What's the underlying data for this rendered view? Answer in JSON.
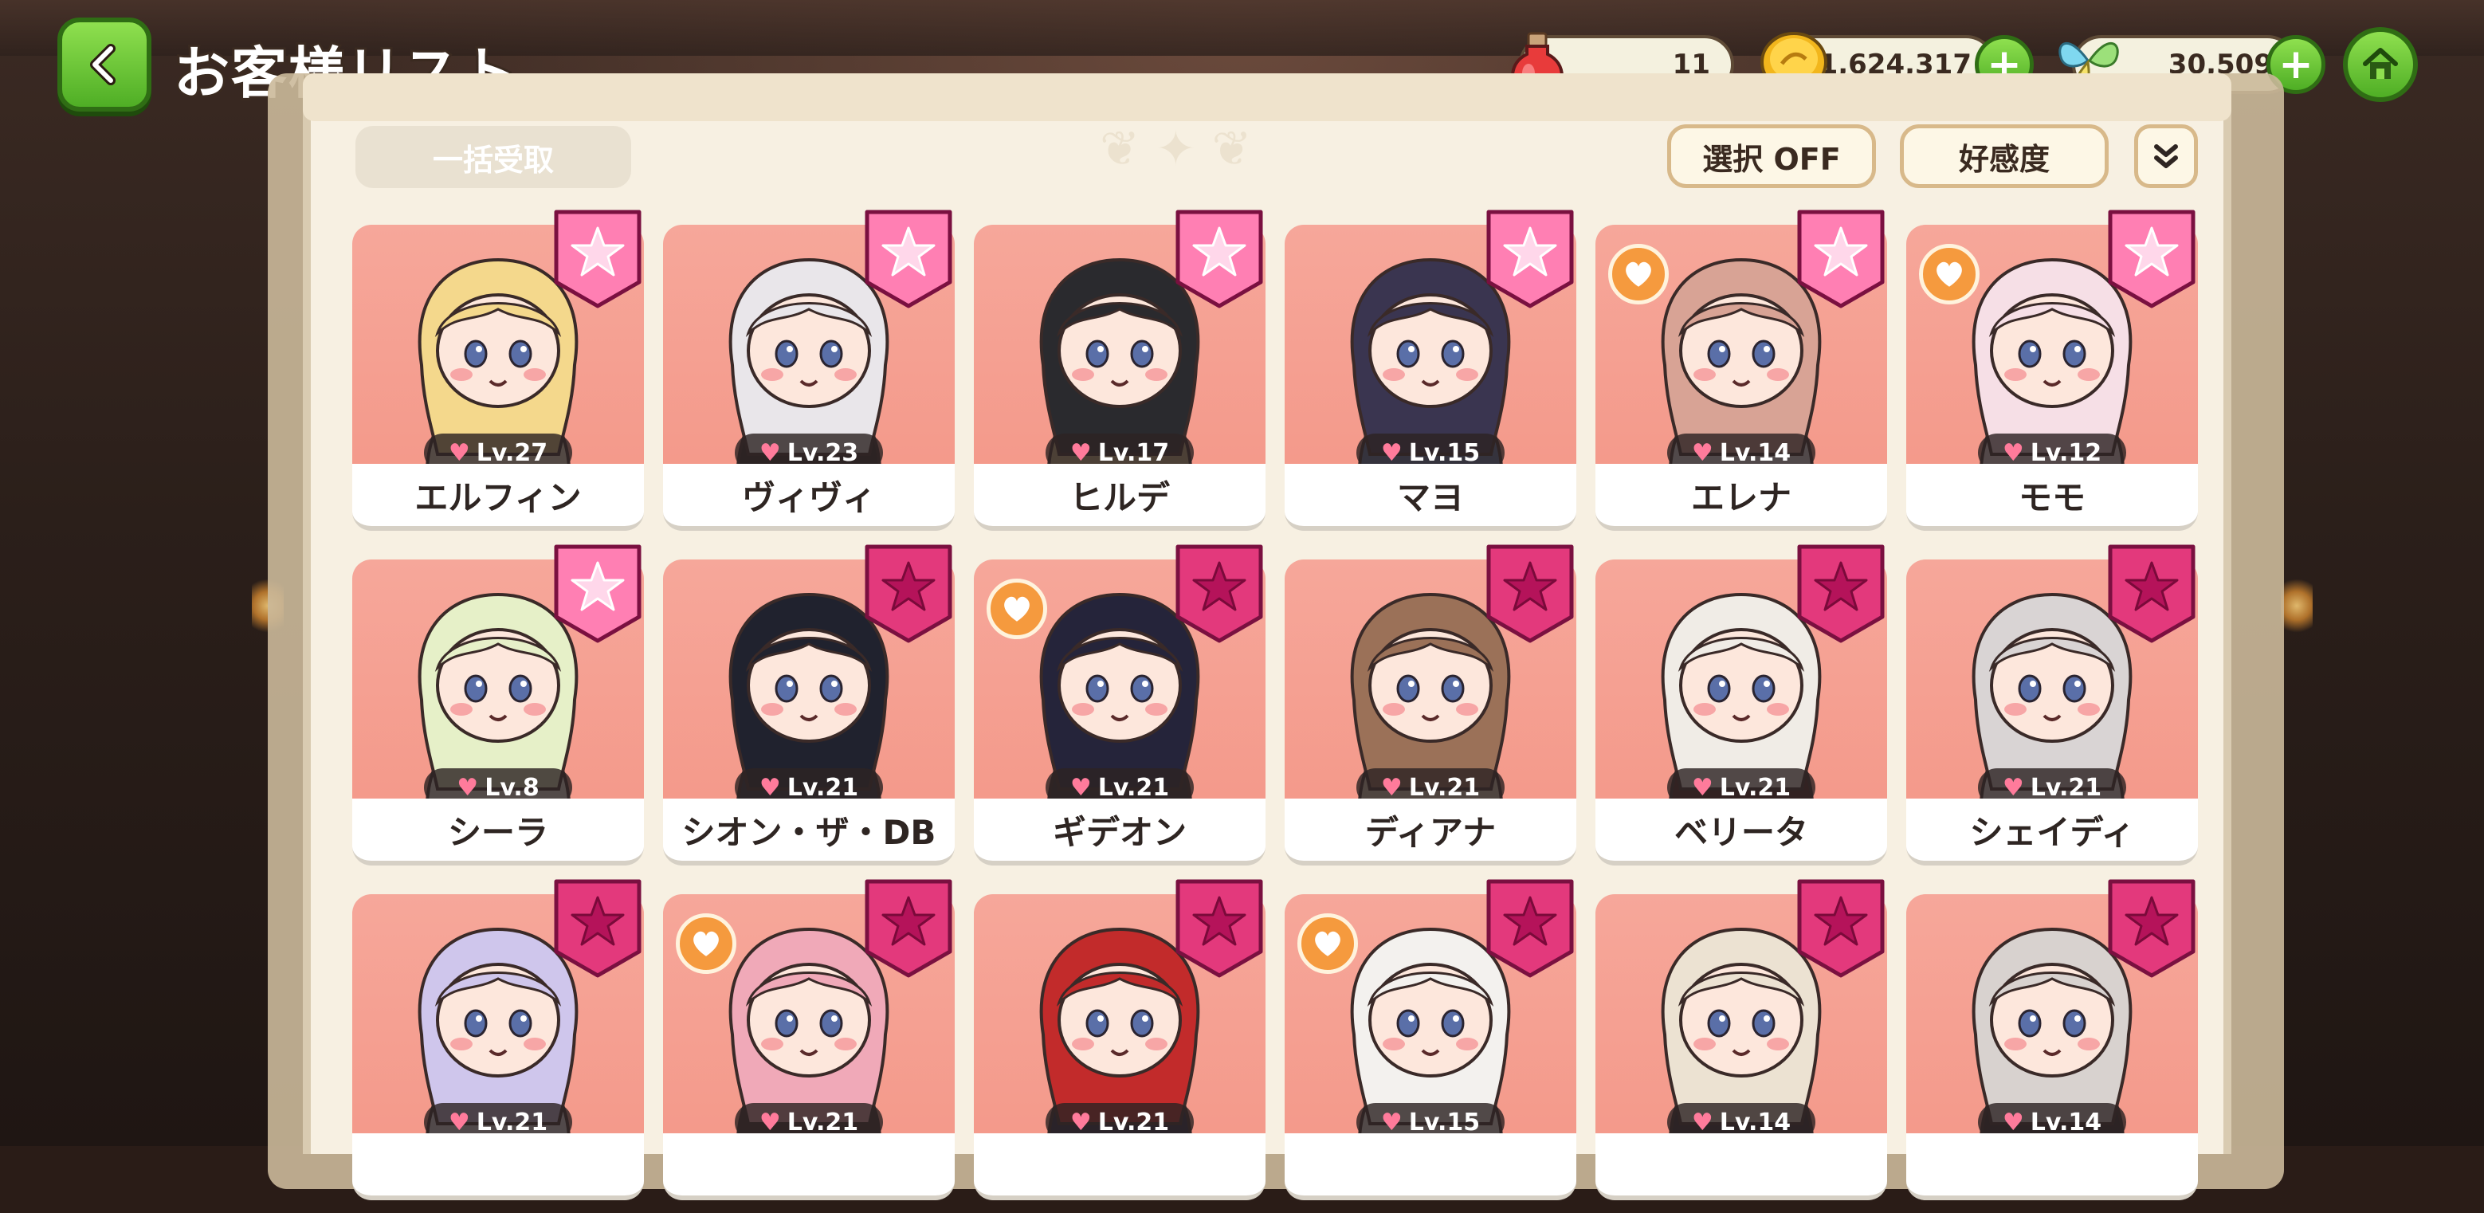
{
  "header": {
    "title": "お客様リスト",
    "resources": [
      {
        "icon": "potion-icon",
        "value": "11"
      },
      {
        "icon": "gold-coin-icon",
        "value": "1,624,317"
      },
      {
        "icon": "fairy-butterfly-icon",
        "value": "30,509"
      }
    ]
  },
  "toolbar": {
    "bulk_claim_label": "一括受取",
    "select_label": "選択 OFF",
    "sort_label": "好感度"
  },
  "colors": {
    "card_bg": "#f6a79a",
    "star_badge_light": "#ff7fb3",
    "star_badge_dark": "#e3397c",
    "heart_orange": "#f59a3e",
    "button_green": "#5fbd2e"
  },
  "customers": [
    {
      "name": "エルフィン",
      "level": "Lv.27",
      "badge": "star-light",
      "heart_badge": false,
      "hair": "#f4d88c",
      "outfit": "#fff3d6"
    },
    {
      "name": "ヴィヴィ",
      "level": "Lv.23",
      "badge": "star-light",
      "heart_badge": false,
      "hair": "#e9e6ea",
      "outfit": "#2b2222"
    },
    {
      "name": "ヒルデ",
      "level": "Lv.17",
      "badge": "star-light",
      "heart_badge": false,
      "hair": "#2a2a2e",
      "outfit": "#d9c08a"
    },
    {
      "name": "マヨ",
      "level": "Lv.15",
      "badge": "star-light",
      "heart_badge": false,
      "hair": "#3a3550",
      "outfit": "#5a7bb0"
    },
    {
      "name": "エレナ",
      "level": "Lv.14",
      "badge": "star-light",
      "heart_badge": true,
      "hair": "#d8a395",
      "outfit": "#f4f4f8"
    },
    {
      "name": "モモ",
      "level": "Lv.12",
      "badge": "star-light",
      "heart_badge": true,
      "hair": "#f6dfe6",
      "outfit": "#fbeff0"
    },
    {
      "name": "シーラ",
      "level": "Lv.8",
      "badge": "star-light",
      "heart_badge": false,
      "hair": "#e6f0c8",
      "outfit": "#f8f6ee"
    },
    {
      "name": "シオン・ザ・DB",
      "level": "Lv.21",
      "badge": "star-dark",
      "heart_badge": false,
      "hair": "#20222e",
      "outfit": "#2a2d3c"
    },
    {
      "name": "ギデオン",
      "level": "Lv.21",
      "badge": "star-dark",
      "heart_badge": true,
      "hair": "#25243a",
      "outfit": "#2e2a30"
    },
    {
      "name": "ディアナ",
      "level": "Lv.21",
      "badge": "star-dark",
      "heart_badge": false,
      "hair": "#9b7158",
      "outfit": "#e9dcc4"
    },
    {
      "name": "ベリータ",
      "level": "Lv.21",
      "badge": "star-dark",
      "heart_badge": false,
      "hair": "#f0ece6",
      "outfit": "#4a1e20"
    },
    {
      "name": "シェイディ",
      "level": "Lv.21",
      "badge": "star-dark",
      "heart_badge": false,
      "hair": "#d9d4d4",
      "outfit": "#f2eeee"
    },
    {
      "name": "",
      "level": "Lv.21",
      "badge": "star-dark",
      "heart_badge": false,
      "hair": "#cfc6ec",
      "outfit": "#f4f2fa"
    },
    {
      "name": "",
      "level": "Lv.21",
      "badge": "star-dark",
      "heart_badge": true,
      "hair": "#f0a9b8",
      "outfit": "#3a2a2a"
    },
    {
      "name": "",
      "level": "Lv.21",
      "badge": "star-dark",
      "heart_badge": false,
      "hair": "#c22b2b",
      "outfit": "#1f2444"
    },
    {
      "name": "",
      "level": "Lv.15",
      "badge": "star-dark",
      "heart_badge": true,
      "hair": "#f3f1ee",
      "outfit": "#faf8f4"
    },
    {
      "name": "",
      "level": "Lv.14",
      "badge": "star-dark",
      "heart_badge": false,
      "hair": "#ece2d2",
      "outfit": "#2a2230"
    },
    {
      "name": "",
      "level": "Lv.14",
      "badge": "star-dark",
      "heart_badge": false,
      "hair": "#d8d2cf",
      "outfit": "#2a2428"
    }
  ]
}
